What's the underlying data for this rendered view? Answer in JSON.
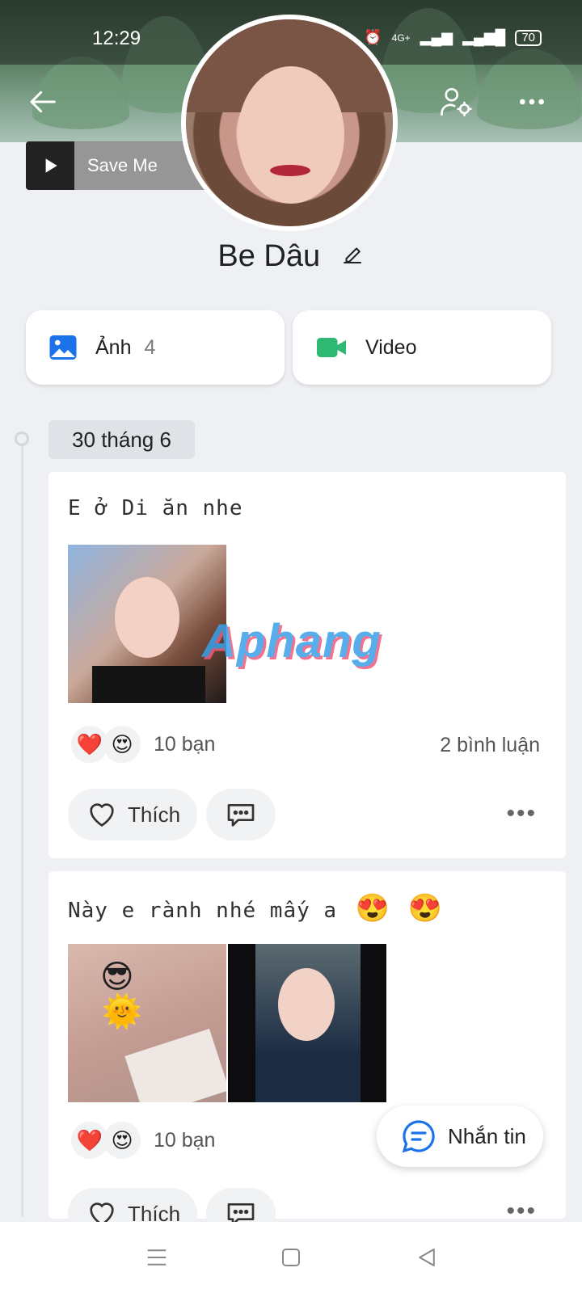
{
  "status_bar": {
    "time": "12:29",
    "network": "4G+",
    "battery": "70"
  },
  "header": {
    "music_title": "Save Me"
  },
  "profile": {
    "name": "Be Dâu"
  },
  "media": {
    "photos_label": "Ảnh",
    "photos_count": "4",
    "video_label": "Video"
  },
  "timeline": {
    "date_label": "30 tháng 6",
    "posts": [
      {
        "text": "E ở Di ăn nhe",
        "reactions_count": "10 bạn",
        "comments_count": "2 bình luận",
        "like_label": "Thích"
      },
      {
        "text": "Này e rành nhé mấy a",
        "emojis": "😍 😍",
        "reactions_count": "10 bạn",
        "like_label": "Thích"
      }
    ]
  },
  "watermark": "Aphang",
  "fab": {
    "label": "Nhắn tin"
  },
  "colors": {
    "accent_blue": "#1a73e8",
    "video_green": "#2eb872",
    "heart_red": "#e8264a"
  }
}
